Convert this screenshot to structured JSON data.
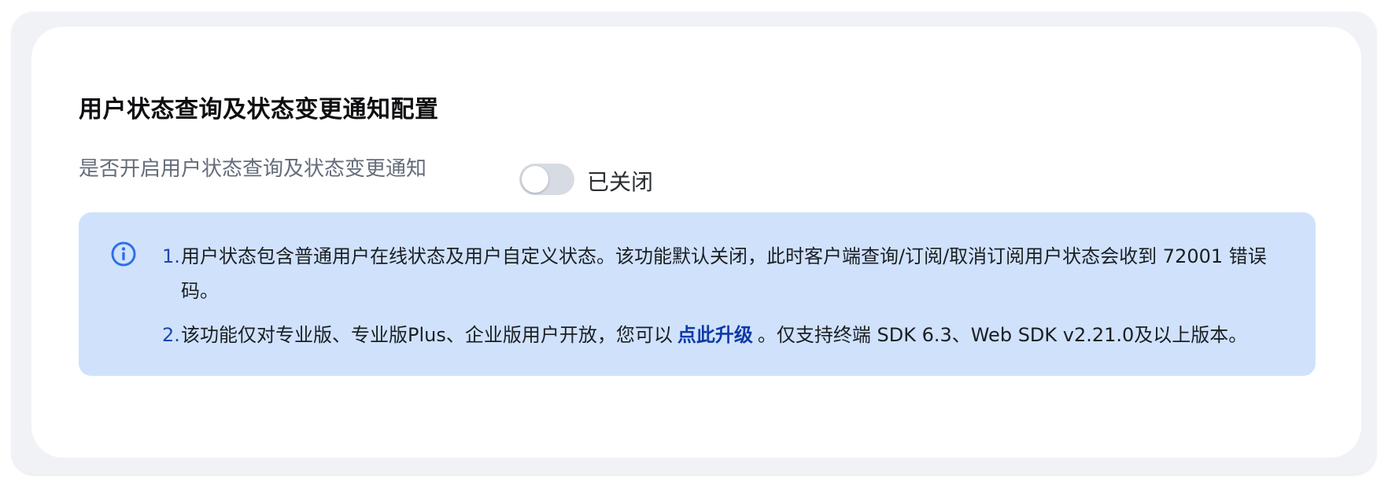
{
  "section": {
    "title": "用户状态查询及状态变更通知配置"
  },
  "setting": {
    "label": "是否开启用户状态查询及状态变更通知",
    "toggle_on": false,
    "status_text": "已关闭"
  },
  "notice": {
    "icon": "info-icon",
    "items": [
      {
        "num": "1.",
        "text": "用户状态包含普通用户在线状态及用户自定义状态。该功能默认关闭，此时客户端查询/订阅/取消订阅用户状态会收到 72001 错误码。"
      },
      {
        "num": "2.",
        "text_before": "该功能仅对专业版、专业版Plus、企业版用户开放，您可以",
        "link": "点此升级",
        "text_after": "。仅支持终端 SDK 6.3、Web SDK v2.21.0及以上版本。"
      }
    ]
  },
  "colors": {
    "notice_bg": "#d0e2fb",
    "accent": "#2047ad",
    "link": "#0d3aa8",
    "toggle_off": "#d7dbe3"
  }
}
